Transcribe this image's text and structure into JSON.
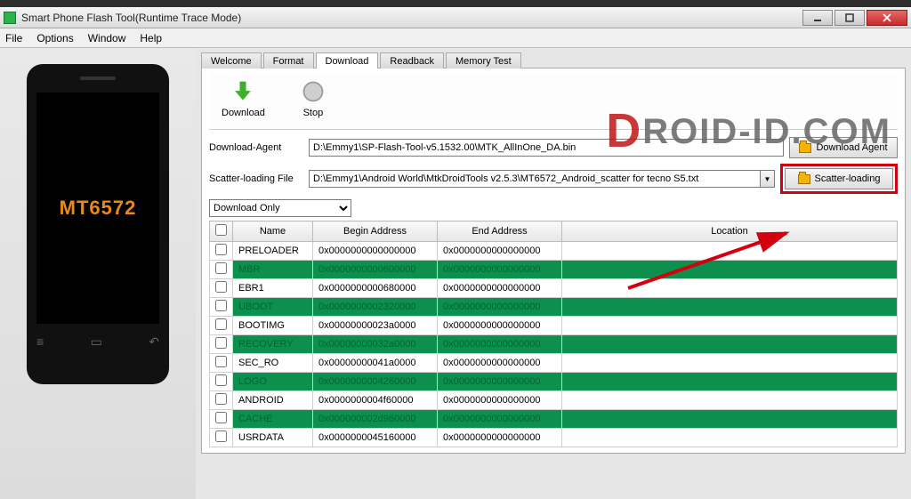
{
  "window": {
    "title": "Smart Phone Flash Tool(Runtime Trace Mode)"
  },
  "menu": {
    "file": "File",
    "options": "Options",
    "window": "Window",
    "help": "Help"
  },
  "phone": {
    "chip": "MT6572"
  },
  "tabs": {
    "welcome": "Welcome",
    "format": "Format",
    "download": "Download",
    "readback": "Readback",
    "memtest": "Memory Test"
  },
  "actions": {
    "download": "Download",
    "stop": "Stop"
  },
  "form": {
    "da_label": "Download-Agent",
    "da_value": "D:\\Emmy1\\SP-Flash-Tool-v5.1532.00\\MTK_AllInOne_DA.bin",
    "da_button": "Download Agent",
    "scatter_label": "Scatter-loading File",
    "scatter_value": "D:\\Emmy1\\Android World\\MtkDroidTools v2.5.3\\MT6572_Android_scatter for tecno S5.txt",
    "scatter_button": "Scatter-loading",
    "mode": "Download Only"
  },
  "table": {
    "head": {
      "name": "Name",
      "begin": "Begin Address",
      "end": "End Address",
      "loc": "Location"
    },
    "rows": [
      {
        "name": "PRELOADER",
        "begin": "0x0000000000000000",
        "end": "0x0000000000000000",
        "green": false
      },
      {
        "name": "MBR",
        "begin": "0x0000000000600000",
        "end": "0x0000000000000000",
        "green": true
      },
      {
        "name": "EBR1",
        "begin": "0x0000000000680000",
        "end": "0x0000000000000000",
        "green": false
      },
      {
        "name": "UBOOT",
        "begin": "0x0000000002320000",
        "end": "0x0000000000000000",
        "green": true
      },
      {
        "name": "BOOTIMG",
        "begin": "0x00000000023a0000",
        "end": "0x0000000000000000",
        "green": false
      },
      {
        "name": "RECOVERY",
        "begin": "0x00000000032a0000",
        "end": "0x0000000000000000",
        "green": true
      },
      {
        "name": "SEC_RO",
        "begin": "0x00000000041a0000",
        "end": "0x0000000000000000",
        "green": false
      },
      {
        "name": "LOGO",
        "begin": "0x0000000004260000",
        "end": "0x0000000000000000",
        "green": true
      },
      {
        "name": "ANDROID",
        "begin": "0x0000000004f60000",
        "end": "0x0000000000000000",
        "green": false
      },
      {
        "name": "CACHE",
        "begin": "0x000000002d960000",
        "end": "0x0000000000000000",
        "green": true
      },
      {
        "name": "USRDATA",
        "begin": "0x0000000045160000",
        "end": "0x0000000000000000",
        "green": false
      }
    ]
  },
  "watermark": {
    "rest": "ROID-ID.COM"
  }
}
